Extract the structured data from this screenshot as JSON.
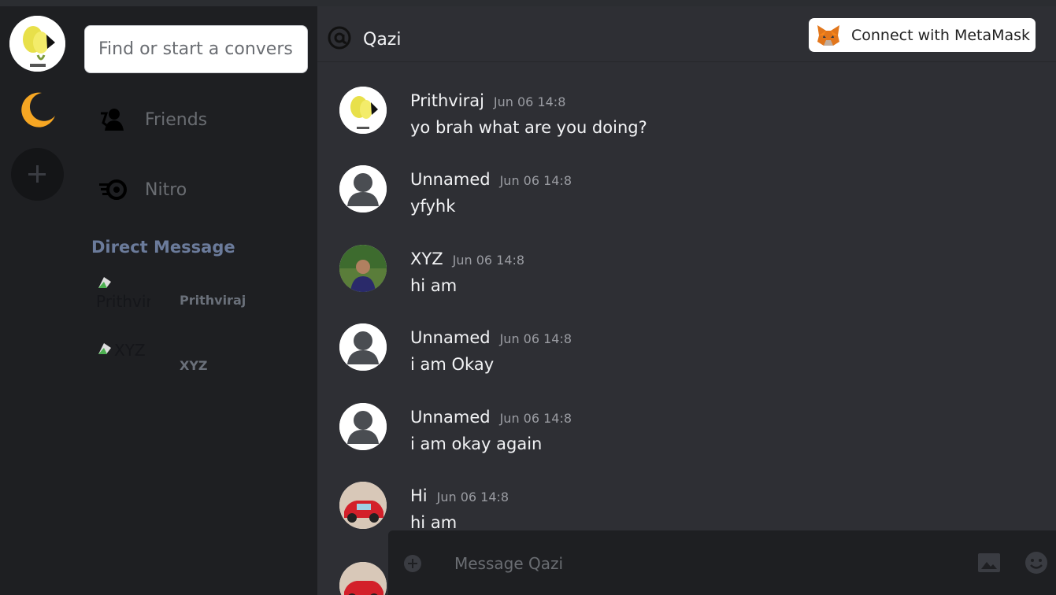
{
  "search": {
    "placeholder": "Find or start a conversation"
  },
  "nav": [
    {
      "label": "Friends",
      "icon": "friends-icon"
    },
    {
      "label": "Nitro",
      "icon": "nitro-icon"
    }
  ],
  "direct_messages": {
    "heading": "Direct Message",
    "items": [
      {
        "alt": "Prithviraj",
        "name": "Prithviraj"
      },
      {
        "alt": "XYZ",
        "name": "XYZ"
      }
    ]
  },
  "header": {
    "channel": "Qazi",
    "connect_label": "Connect with MetaMask"
  },
  "messages": [
    {
      "author": "Prithviraj",
      "time": "Jun 06 14:8",
      "text": "yo brah what are you doing?",
      "avatar": "lemon"
    },
    {
      "author": "Unnamed",
      "time": "Jun 06 14:8",
      "text": "yfyhk",
      "avatar": "default"
    },
    {
      "author": "XYZ",
      "time": "Jun 06 14:8",
      "text": "hi am",
      "avatar": "photo-person"
    },
    {
      "author": "Unnamed",
      "time": "Jun 06 14:8",
      "text": "i am Okay",
      "avatar": "default"
    },
    {
      "author": "Unnamed",
      "time": "Jun 06 14:8",
      "text": "i am okay again",
      "avatar": "default"
    },
    {
      "author": "Hi",
      "time": "Jun 06 14:8",
      "text": "hi am",
      "avatar": "photo-car"
    }
  ],
  "composer": {
    "placeholder": "Message Qazi"
  },
  "colors": {
    "accent_moon": "#f6a623",
    "background": "#2e2f34",
    "sidebar": "#1e1f22"
  }
}
